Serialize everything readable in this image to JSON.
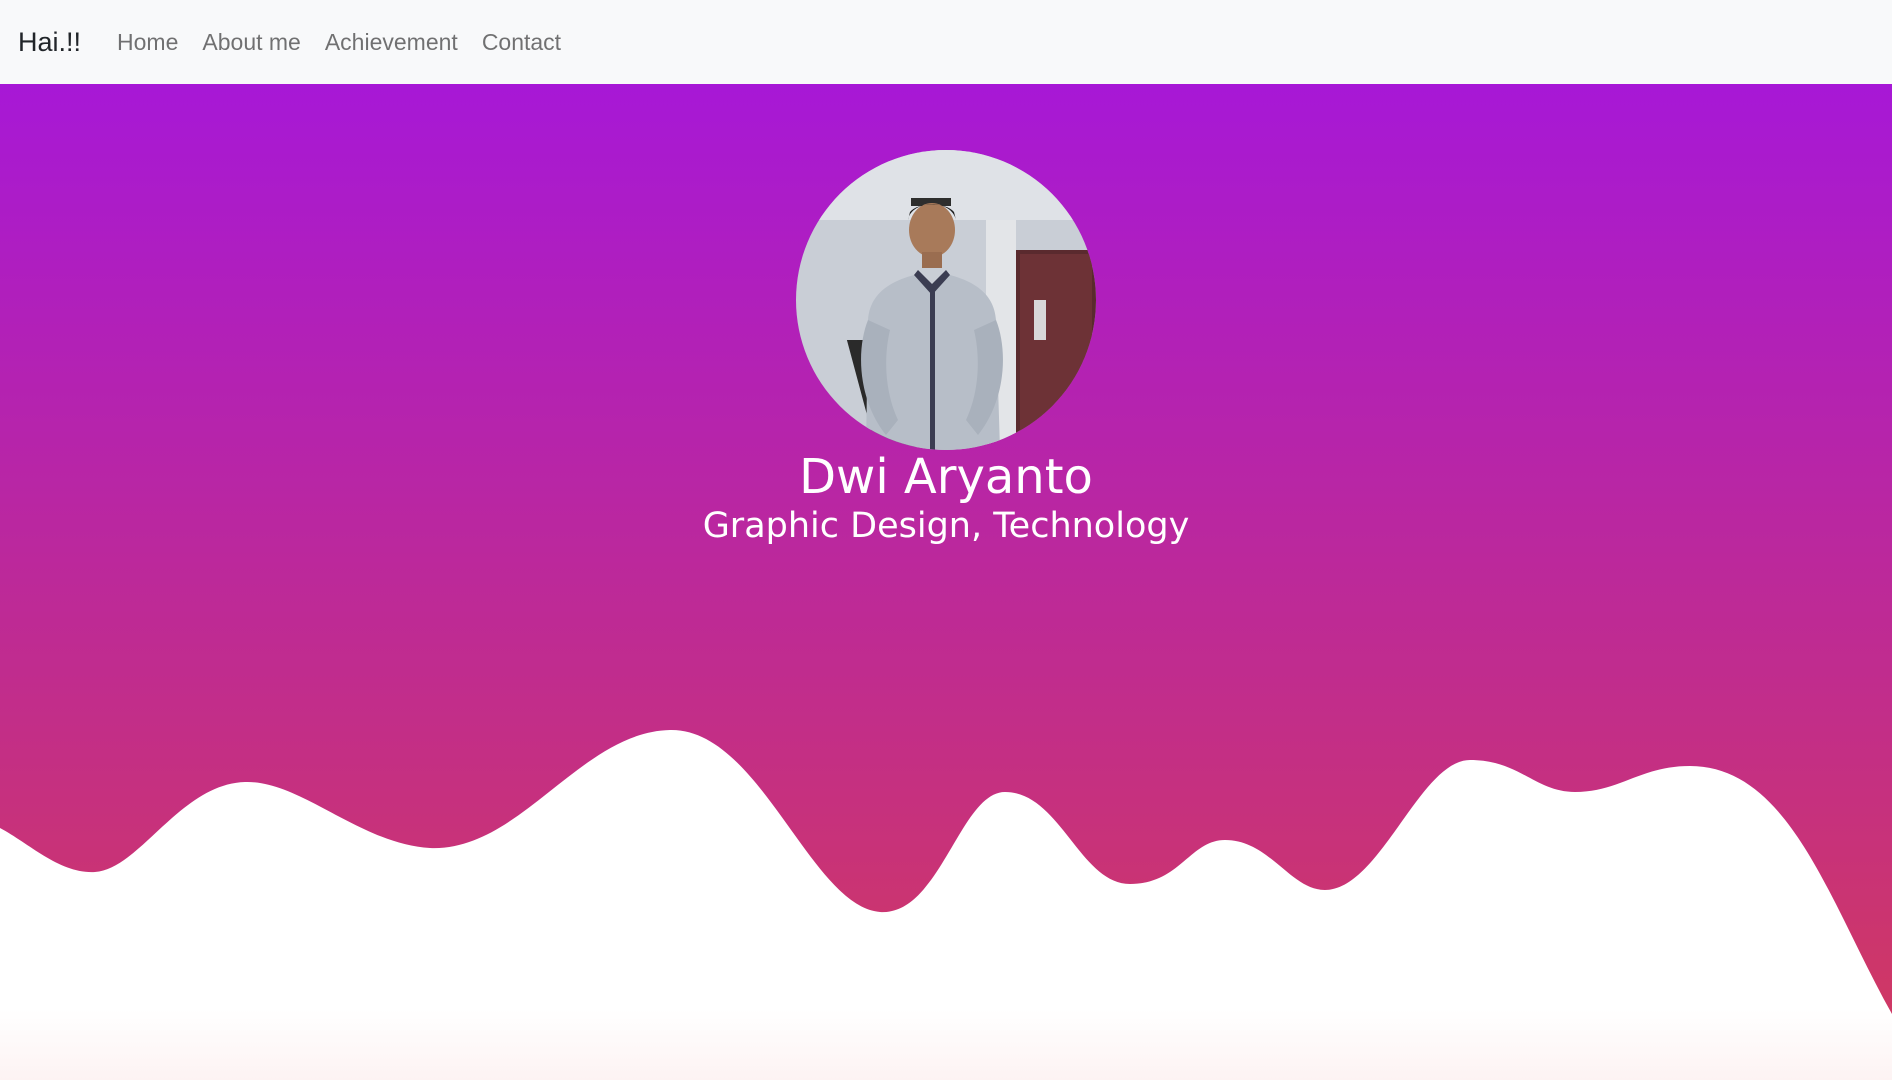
{
  "navbar": {
    "brand": "Hai.!!",
    "items": [
      {
        "label": "Home"
      },
      {
        "label": "About me"
      },
      {
        "label": "Achievement"
      },
      {
        "label": "Contact"
      }
    ]
  },
  "hero": {
    "name": "Dwi Aryanto",
    "tagline": "Graphic Design, Technology",
    "gradient_top": "#a718d6",
    "gradient_bottom": "#d23a5c",
    "wave_color": "#ffffff",
    "avatar_icon": "profile-photo"
  }
}
